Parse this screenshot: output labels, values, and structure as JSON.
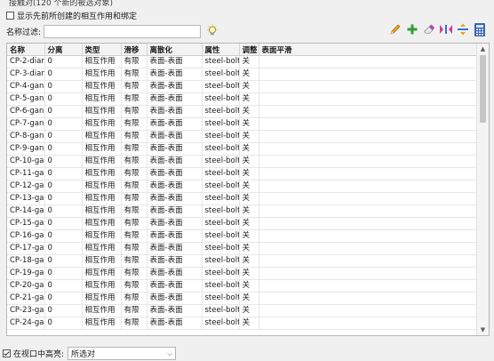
{
  "top_clipped_text": "接触对(120 个新的被选对象)",
  "show_prev_checkbox": {
    "label": "显示先前所创建的相互作用和绑定",
    "checked": false
  },
  "filter": {
    "label": "名称过滤:",
    "value": ""
  },
  "toolbar": {
    "icons": [
      "pencil-icon",
      "plus-icon",
      "eraser-icon",
      "swap-icon",
      "split-icon",
      "calculator-icon"
    ]
  },
  "table": {
    "columns": [
      "名称",
      "分离",
      "类型",
      "滑移",
      "离散化",
      "属性",
      "调整",
      "表面平滑"
    ],
    "rows": [
      [
        "CP-2-diar",
        "0",
        "相互作用",
        "有限",
        "表面-表面",
        "steel-bolt",
        "关",
        ""
      ],
      [
        "CP-3-diar",
        "0",
        "相互作用",
        "有限",
        "表面-表面",
        "steel-bolt",
        "关",
        ""
      ],
      [
        "CP-4-gan",
        "0",
        "相互作用",
        "有限",
        "表面-表面",
        "steel-bolt",
        "关",
        ""
      ],
      [
        "CP-5-gan",
        "0",
        "相互作用",
        "有限",
        "表面-表面",
        "steel-bolt",
        "关",
        ""
      ],
      [
        "CP-6-gan",
        "0",
        "相互作用",
        "有限",
        "表面-表面",
        "steel-bolt",
        "关",
        ""
      ],
      [
        "CP-7-gan",
        "0",
        "相互作用",
        "有限",
        "表面-表面",
        "steel-bolt",
        "关",
        ""
      ],
      [
        "CP-8-gan",
        "0",
        "相互作用",
        "有限",
        "表面-表面",
        "steel-bolt",
        "关",
        ""
      ],
      [
        "CP-9-gan",
        "0",
        "相互作用",
        "有限",
        "表面-表面",
        "steel-bolt",
        "关",
        ""
      ],
      [
        "CP-10-ga",
        "0",
        "相互作用",
        "有限",
        "表面-表面",
        "steel-bolt",
        "关",
        ""
      ],
      [
        "CP-11-ga",
        "0",
        "相互作用",
        "有限",
        "表面-表面",
        "steel-bolt",
        "关",
        ""
      ],
      [
        "CP-12-ga",
        "0",
        "相互作用",
        "有限",
        "表面-表面",
        "steel-bolt",
        "关",
        ""
      ],
      [
        "CP-13-ga",
        "0",
        "相互作用",
        "有限",
        "表面-表面",
        "steel-bolt",
        "关",
        ""
      ],
      [
        "CP-14-ga",
        "0",
        "相互作用",
        "有限",
        "表面-表面",
        "steel-bolt",
        "关",
        ""
      ],
      [
        "CP-15-ga",
        "0",
        "相互作用",
        "有限",
        "表面-表面",
        "steel-bolt",
        "关",
        ""
      ],
      [
        "CP-16-ga",
        "0",
        "相互作用",
        "有限",
        "表面-表面",
        "steel-bolt",
        "关",
        ""
      ],
      [
        "CP-17-ga",
        "0",
        "相互作用",
        "有限",
        "表面-表面",
        "steel-bolt",
        "关",
        ""
      ],
      [
        "CP-18-ga",
        "0",
        "相互作用",
        "有限",
        "表面-表面",
        "steel-bolt",
        "关",
        ""
      ],
      [
        "CP-19-ga",
        "0",
        "相互作用",
        "有限",
        "表面-表面",
        "steel-bolt",
        "关",
        ""
      ],
      [
        "CP-20-ga",
        "0",
        "相互作用",
        "有限",
        "表面-表面",
        "steel-bolt",
        "关",
        ""
      ],
      [
        "CP-21-ga",
        "0",
        "相互作用",
        "有限",
        "表面-表面",
        "steel-bolt",
        "关",
        ""
      ],
      [
        "CP-23-ga",
        "0",
        "相互作用",
        "有限",
        "表面-表面",
        "steel-bolt",
        "关",
        ""
      ],
      [
        "CP-24-ga",
        "0",
        "相互作用",
        "有限",
        "表面-表面",
        "steel-bolt",
        "关",
        ""
      ]
    ]
  },
  "highlight": {
    "label": "在视口中高亮:",
    "checked": true,
    "selected": "所选对"
  },
  "colors": {
    "pencil": "#e8a317",
    "plus": "#2e9e3a",
    "eraser": "#b048b8",
    "swap": "#cc3c9c",
    "split": "#3a6fd8",
    "calculator": "#2f62b5"
  }
}
